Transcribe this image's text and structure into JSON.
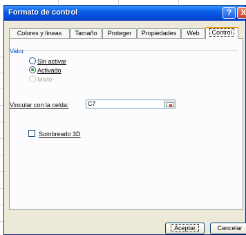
{
  "dialog": {
    "title": "Formato de control",
    "help_glyph": "?",
    "close_glyph": "X"
  },
  "tabs": [
    {
      "label": "Colores y líneas"
    },
    {
      "label": "Tamaño"
    },
    {
      "label": "Proteger"
    },
    {
      "label": "Propiedades"
    },
    {
      "label": "Web"
    },
    {
      "label": "Control",
      "active": true
    }
  ],
  "value_group": {
    "legend": "Valor",
    "options": [
      {
        "label": "Sin activar",
        "checked": false,
        "enabled": true
      },
      {
        "label": "Activado",
        "checked": true,
        "enabled": true
      },
      {
        "label": "Mixto",
        "checked": false,
        "enabled": false
      }
    ]
  },
  "cell_link": {
    "label": "Vincular con la celda:",
    "value": "C7"
  },
  "shading": {
    "label": "Sombreado 3D",
    "checked": false
  },
  "buttons": {
    "accept": "Aceptar",
    "cancel": "Cancelar"
  },
  "colors": {
    "titlebar": "#0a5fe6",
    "legend": "#0046d5",
    "active_tab_accent": "#e8a200",
    "close_button": "#c7432a"
  }
}
